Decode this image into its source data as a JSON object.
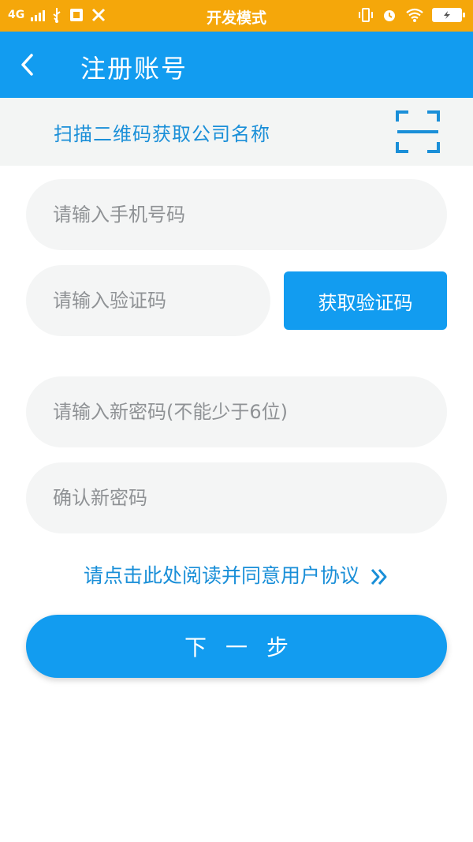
{
  "status_bar": {
    "network": "4G",
    "mode_title": "开发模式"
  },
  "header": {
    "title": "注册账号"
  },
  "scan": {
    "label": "扫描二维码获取公司名称"
  },
  "form": {
    "phone_placeholder": "请输入手机号码",
    "code_placeholder": "请输入验证码",
    "get_code_label": "获取验证码",
    "password_placeholder": "请输入新密码(不能少于6位)",
    "confirm_placeholder": "确认新密码"
  },
  "agreement": {
    "text": "请点击此处阅读并同意用户协议"
  },
  "next_button": {
    "label": "下一步"
  },
  "colors": {
    "status_bar": "#f5a70a",
    "primary": "#129cf0",
    "link": "#1a8fd8",
    "field_bg": "#f4f5f5"
  }
}
